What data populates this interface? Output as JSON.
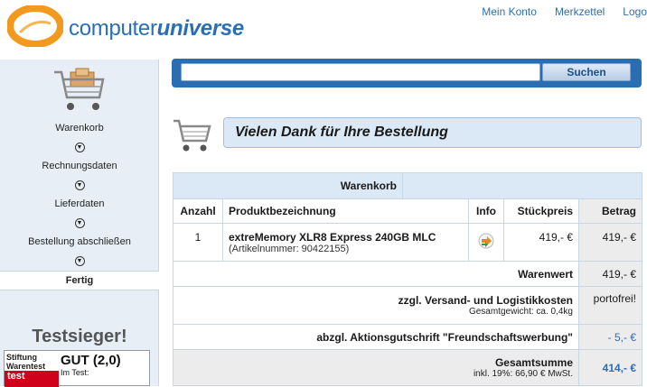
{
  "header": {
    "brand_prefix": "computer",
    "brand_suffix": "universe",
    "nav": [
      "Mein Konto",
      "Merkzettel",
      "Logo"
    ]
  },
  "sidebar": {
    "steps": [
      "Warenkorb",
      "Rechnungsdaten",
      "Lieferdaten",
      "Bestellung abschließen"
    ],
    "active_step": "Fertig",
    "testsieger": "Testsieger!",
    "badge": {
      "org_line1": "Stiftung",
      "org_line2": "Warentest",
      "org_short": "test",
      "grade": "GUT (2,0)",
      "subtitle": "Im Test:"
    }
  },
  "search": {
    "value": "",
    "button": "Suchen"
  },
  "thanks_message": "Vielen Dank für Ihre Bestellung",
  "cart": {
    "title": "Warenkorb",
    "columns": [
      "Anzahl",
      "Produktbezeichnung",
      "Info",
      "Stückpreis",
      "Betrag"
    ],
    "items": [
      {
        "qty": "1",
        "name": "extreMemory XLR8 Express 240GB MLC",
        "article": "(Artikelnummer: 90422155)",
        "unit_price": "419,- €",
        "total": "419,- €"
      }
    ],
    "warenwert_label": "Warenwert",
    "warenwert_value": "419,- €",
    "shipping_label": "zzgl. Versand- und Logistikkosten",
    "shipping_sub": "Gesamtgewicht: ca. 0,4kg",
    "shipping_value": "portofrei!",
    "voucher_label": "abzgl. Aktionsgutschrift \"Freundschaftswerbung\"",
    "voucher_value": "- 5,- €",
    "total_label": "Gesamtsumme",
    "total_sub": "inkl. 19%: 66,90 € MwSt.",
    "total_value": "414,- €"
  },
  "colors": {
    "brand_blue": "#2a6fb5",
    "logo_orange": "#f39a1e"
  }
}
